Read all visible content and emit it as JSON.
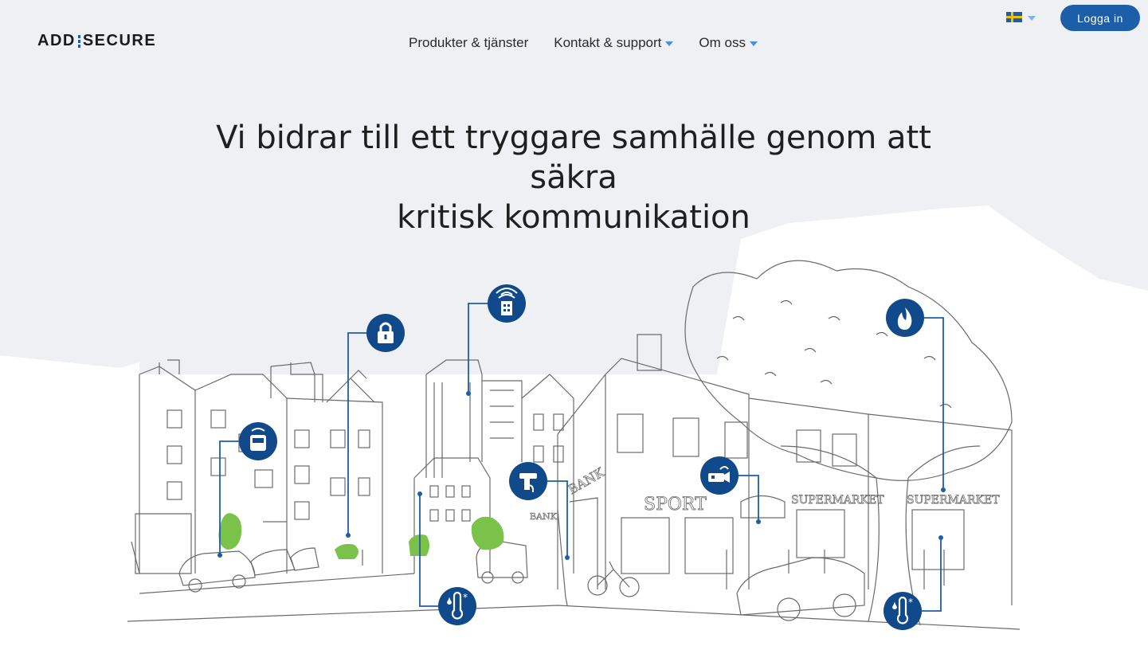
{
  "header": {
    "logo_left": "ADD",
    "logo_right": "SECURE",
    "nav": [
      {
        "label": "Produkter & tjänster",
        "has_dropdown": false
      },
      {
        "label": "Kontakt & support",
        "has_dropdown": true
      },
      {
        "label": "Om oss",
        "has_dropdown": true
      }
    ],
    "language_flag": "sweden-flag-icon",
    "login_label": "Logga in"
  },
  "hero": {
    "title_line1": "Vi bidrar till ett tryggare samhälle genom att säkra",
    "title_line2": "kritisk kommunikation"
  },
  "illustration": {
    "shop_signs": [
      "SPORT",
      "SUPERMARKET",
      "SUPERMARKET",
      "BANK",
      "BANK"
    ],
    "icons": [
      "bus-icon",
      "lock-icon",
      "building-wifi-icon",
      "thermometer-icon",
      "atm-icon",
      "camera-icon",
      "fire-icon",
      "thermometer-icon"
    ]
  },
  "colors": {
    "brand_blue": "#1d5ea8",
    "icon_blue": "#104a8a",
    "tree_green": "#7bc24a",
    "background": "#eef0f3"
  }
}
